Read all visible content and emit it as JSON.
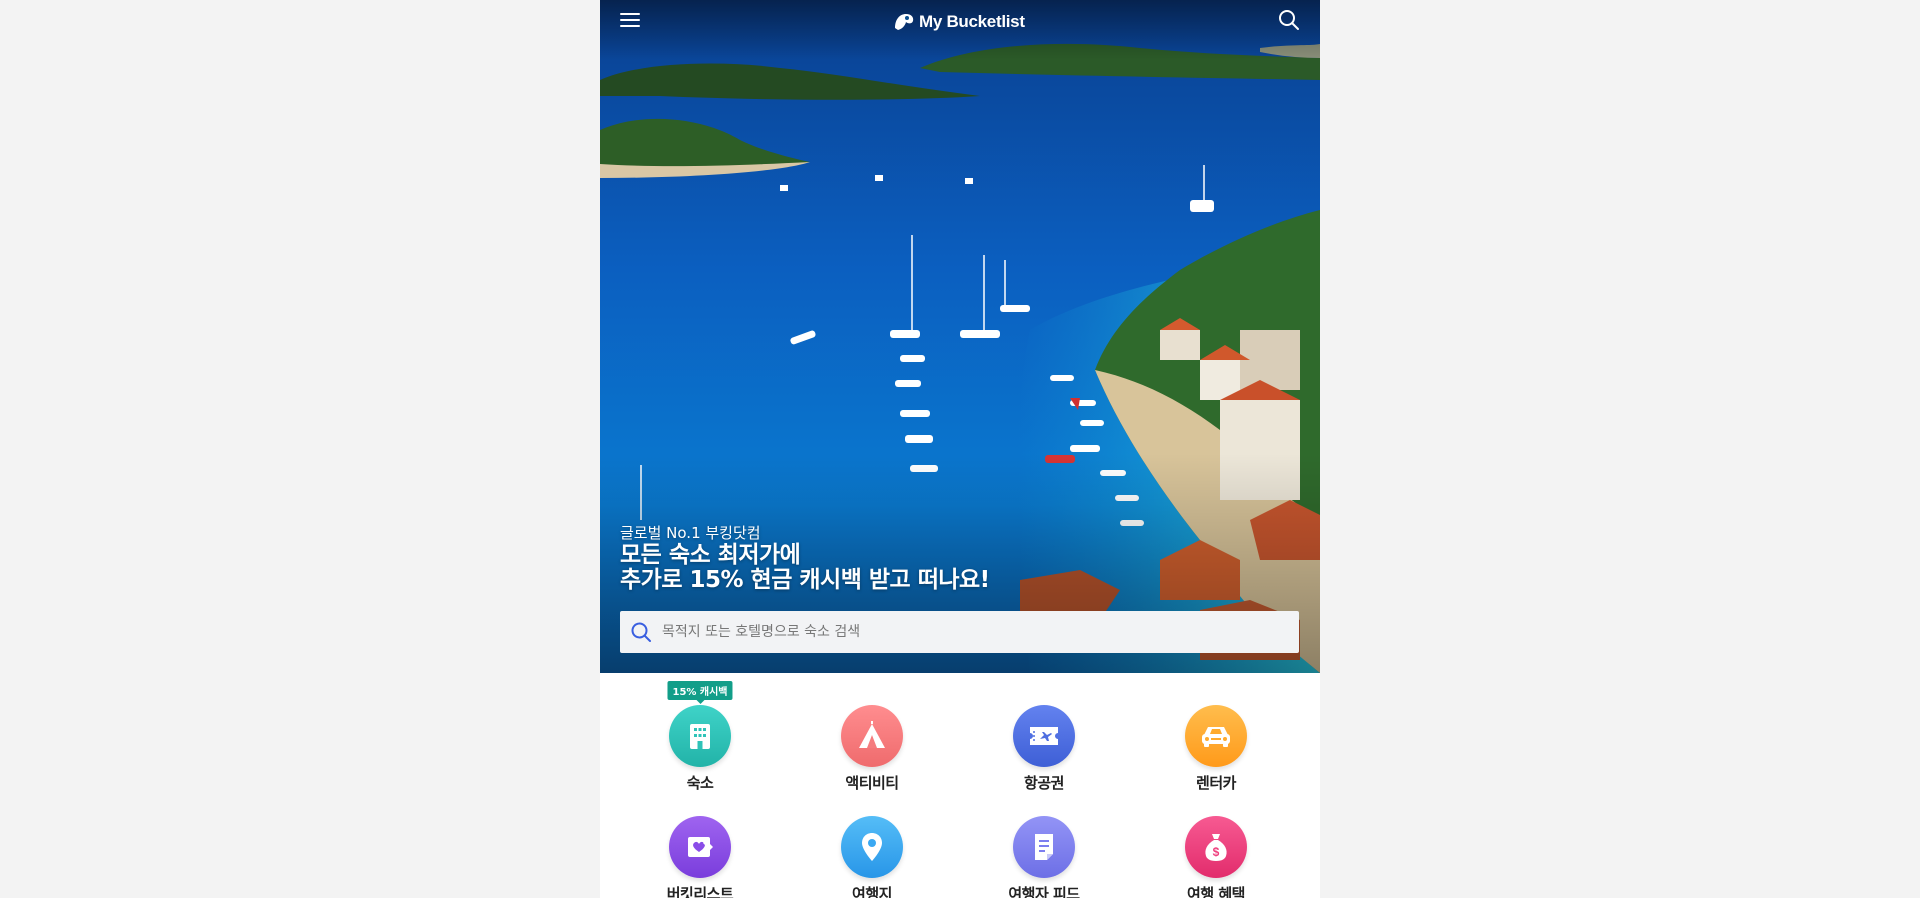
{
  "header": {
    "logo_text": "My Bucketlist",
    "menu_icon": "hamburger-menu-icon",
    "search_icon": "search-icon"
  },
  "hero": {
    "subtitle": "글로벌 No.1 부킹닷컴",
    "title_line1": "모든 숙소 최저가에",
    "title_line2": "추가로 15% 현금 캐시백 받고 떠나요!",
    "search_placeholder": "목적지 또는 호텔명으로 숙소 검색"
  },
  "categories": [
    {
      "label": "숙소",
      "icon": "hotel-icon",
      "color": "#2fc3b8",
      "badge": "15% 캐시백"
    },
    {
      "label": "액티비티",
      "icon": "tent-icon",
      "color": "#f57c7e"
    },
    {
      "label": "항공권",
      "icon": "plane-ticket-icon",
      "color": "#4f6fe0"
    },
    {
      "label": "렌터카",
      "icon": "car-icon",
      "color": "#ffab2e"
    },
    {
      "label": "버킷리스트",
      "icon": "heart-note-icon",
      "color": "#8a4de8"
    },
    {
      "label": "여행지",
      "icon": "map-pin-icon",
      "color": "#3aa8f2"
    },
    {
      "label": "여행자 피드",
      "icon": "document-icon",
      "color": "#7c7ef0"
    },
    {
      "label": "여행 혜택",
      "icon": "money-bag-icon",
      "color": "#ef3f7e"
    }
  ]
}
